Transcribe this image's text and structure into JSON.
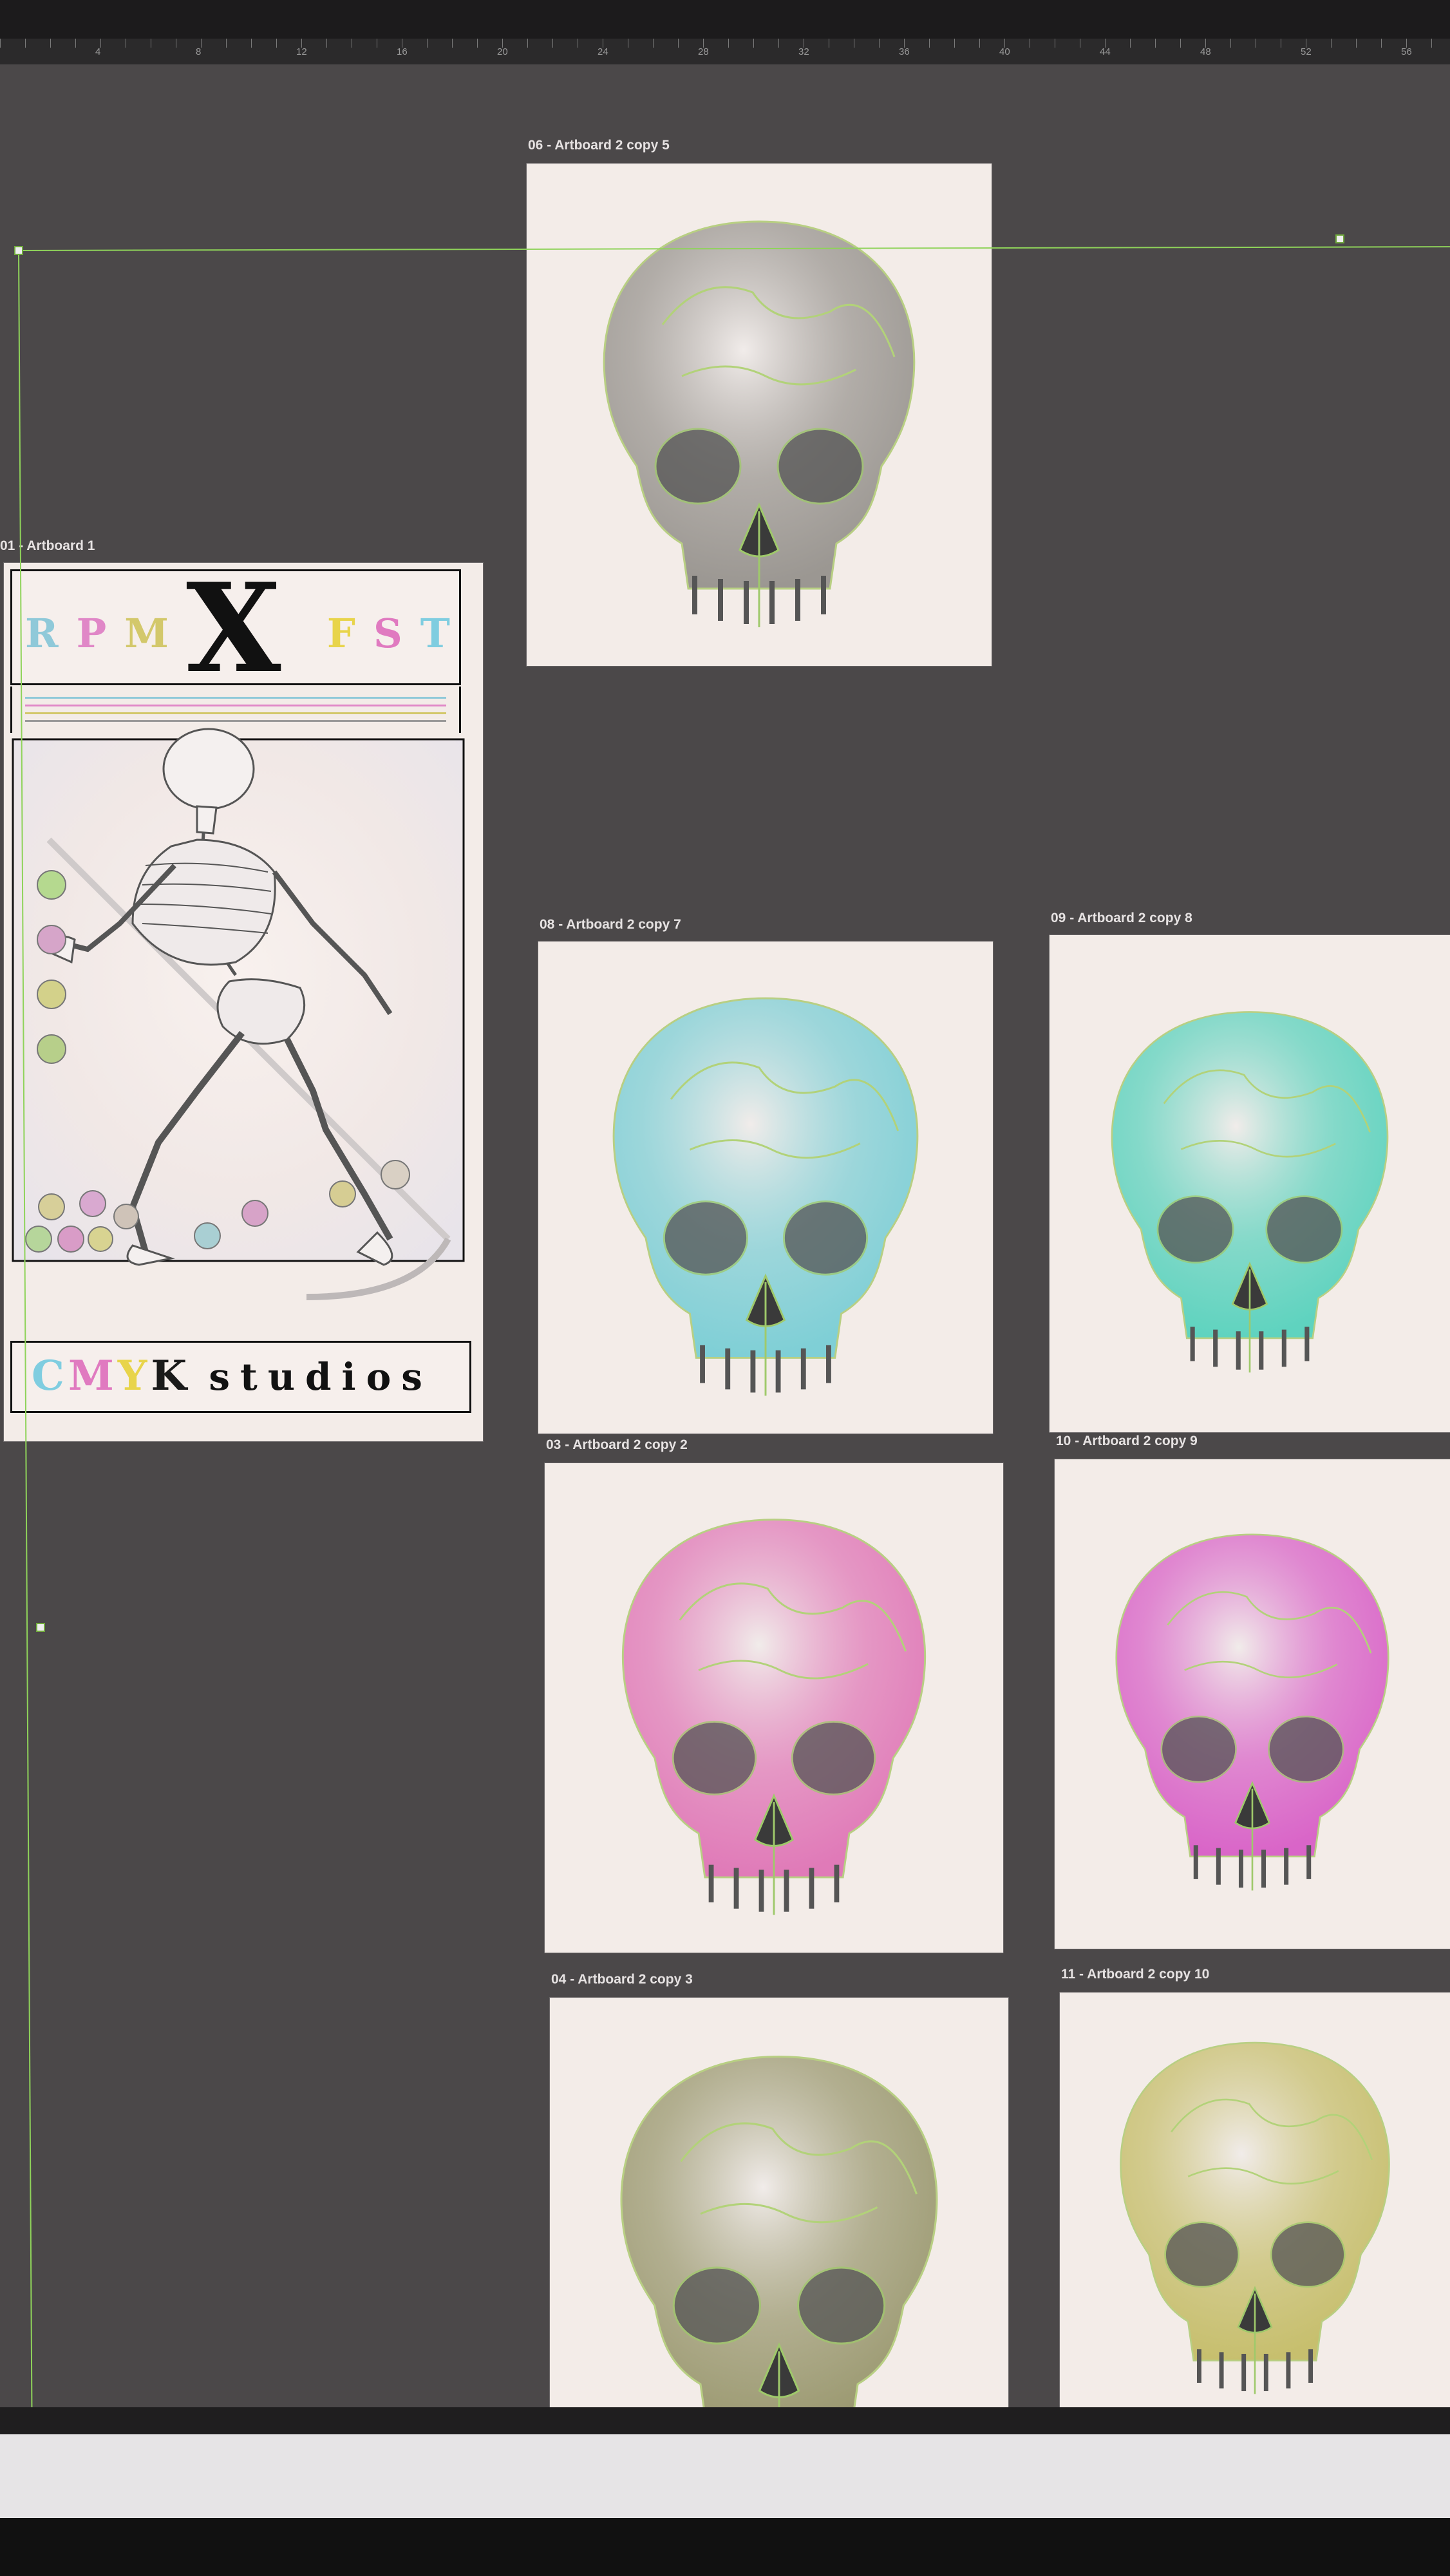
{
  "app": {
    "ruler_numbers": [
      "4",
      "8",
      "12",
      "16",
      "20",
      "24",
      "28",
      "32",
      "36",
      "40",
      "44",
      "48",
      "52",
      "56"
    ]
  },
  "artboards": [
    {
      "id": "ab01",
      "label": "01 - Artboard 1"
    },
    {
      "id": "ab06",
      "label": "06 - Artboard 2 copy 5",
      "skull_color": "#9b9792"
    },
    {
      "id": "ab08",
      "label": "08 - Artboard 2 copy 7",
      "skull_color": "#7fcfd6"
    },
    {
      "id": "ab09",
      "label": "09 - Artboard 2 copy 8",
      "skull_color": "#5fd3bf"
    },
    {
      "id": "ab03",
      "label": "03 - Artboard 2 copy 2",
      "skull_color": "#e07ab8"
    },
    {
      "id": "ab10",
      "label": "10 - Artboard 2 copy 9",
      "skull_color": "#d965c8"
    },
    {
      "id": "ab04",
      "label": "04 - Artboard 2 copy 3",
      "skull_color": "#9c9a72"
    },
    {
      "id": "ab11",
      "label": "11 - Artboard 2 copy 10",
      "skull_color": "#c7bf6e"
    }
  ],
  "card": {
    "top_letters": [
      "R",
      "P",
      "M",
      "F",
      "S",
      "T"
    ],
    "top_letter_colors": [
      "#8fc9d9",
      "#e087c7",
      "#d3c86b",
      "#e8d44a",
      "#e07ac0",
      "#7fcde0"
    ],
    "big_letter": "X",
    "bottom_letters": [
      "C",
      "M",
      "Y",
      "K"
    ],
    "bottom_letter_colors": [
      "#7fcde0",
      "#e07ac0",
      "#e8d44a",
      "#1a1a1a"
    ],
    "bottom_word": "studios",
    "stripe_colors": [
      "#8fc9d9",
      "#e087c7",
      "#d3c86b",
      "#9a9a9a"
    ]
  },
  "colors": {
    "guide": "#8fd35a",
    "canvas": "#4b4849",
    "artboard": "#f3ece8"
  }
}
